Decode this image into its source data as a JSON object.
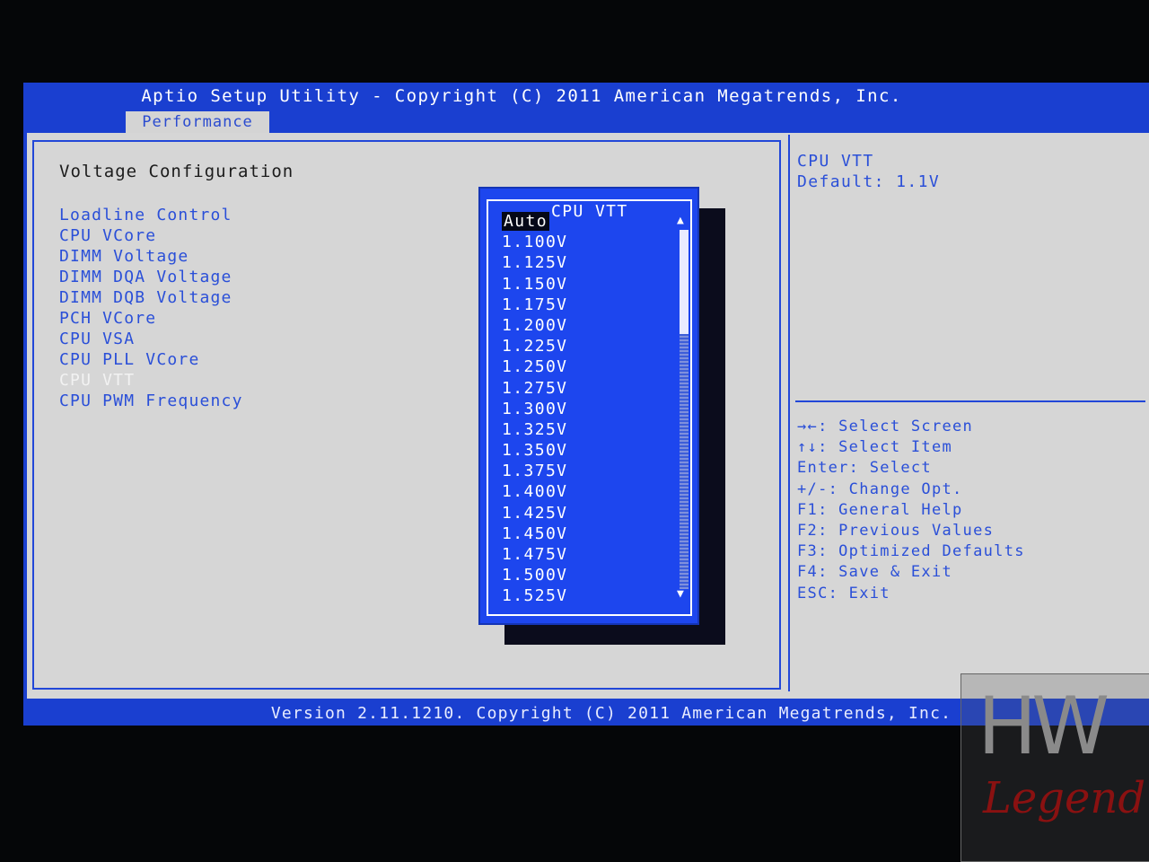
{
  "header": {
    "title": "Aptio Setup Utility - Copyright (C) 2011 American Megatrends, Inc.",
    "active_tab": "Performance"
  },
  "left": {
    "section_title": "Voltage Configuration",
    "items": [
      {
        "label": "Loadline Control"
      },
      {
        "label": "CPU VCore"
      },
      {
        "label": "DIMM Voltage"
      },
      {
        "label": "DIMM DQA Voltage"
      },
      {
        "label": "DIMM DQB Voltage"
      },
      {
        "label": "PCH VCore"
      },
      {
        "label": "CPU VSA"
      },
      {
        "label": "CPU PLL VCore"
      },
      {
        "label": "CPU VTT",
        "selected": true
      },
      {
        "label": "CPU PWM Frequency"
      }
    ]
  },
  "popup": {
    "title": "CPU VTT",
    "selected": "Auto",
    "options": [
      "Auto",
      "1.100V",
      "1.125V",
      "1.150V",
      "1.175V",
      "1.200V",
      "1.225V",
      "1.250V",
      "1.275V",
      "1.300V",
      "1.325V",
      "1.350V",
      "1.375V",
      "1.400V",
      "1.425V",
      "1.450V",
      "1.475V",
      "1.500V",
      "1.525V"
    ]
  },
  "help": {
    "line1": "CPU VTT",
    "line2": "Default: 1.1V"
  },
  "keys": [
    "→←: Select Screen",
    "↑↓: Select Item",
    "Enter: Select",
    "+/-: Change Opt.",
    "F1: General Help",
    "F2: Previous Values",
    "F3: Optimized Defaults",
    "F4: Save & Exit",
    "ESC: Exit"
  ],
  "footer": {
    "text": "Version 2.11.1210. Copyright (C) 2011 American Megatrends, Inc."
  },
  "watermark": {
    "top": "HW",
    "bottom": "Legend"
  },
  "colors": {
    "bios_blue": "#1a3fd0",
    "panel_gray": "#d6d6d6",
    "item_blue": "#2a4fd8",
    "popup_blue": "#1d46ee"
  }
}
